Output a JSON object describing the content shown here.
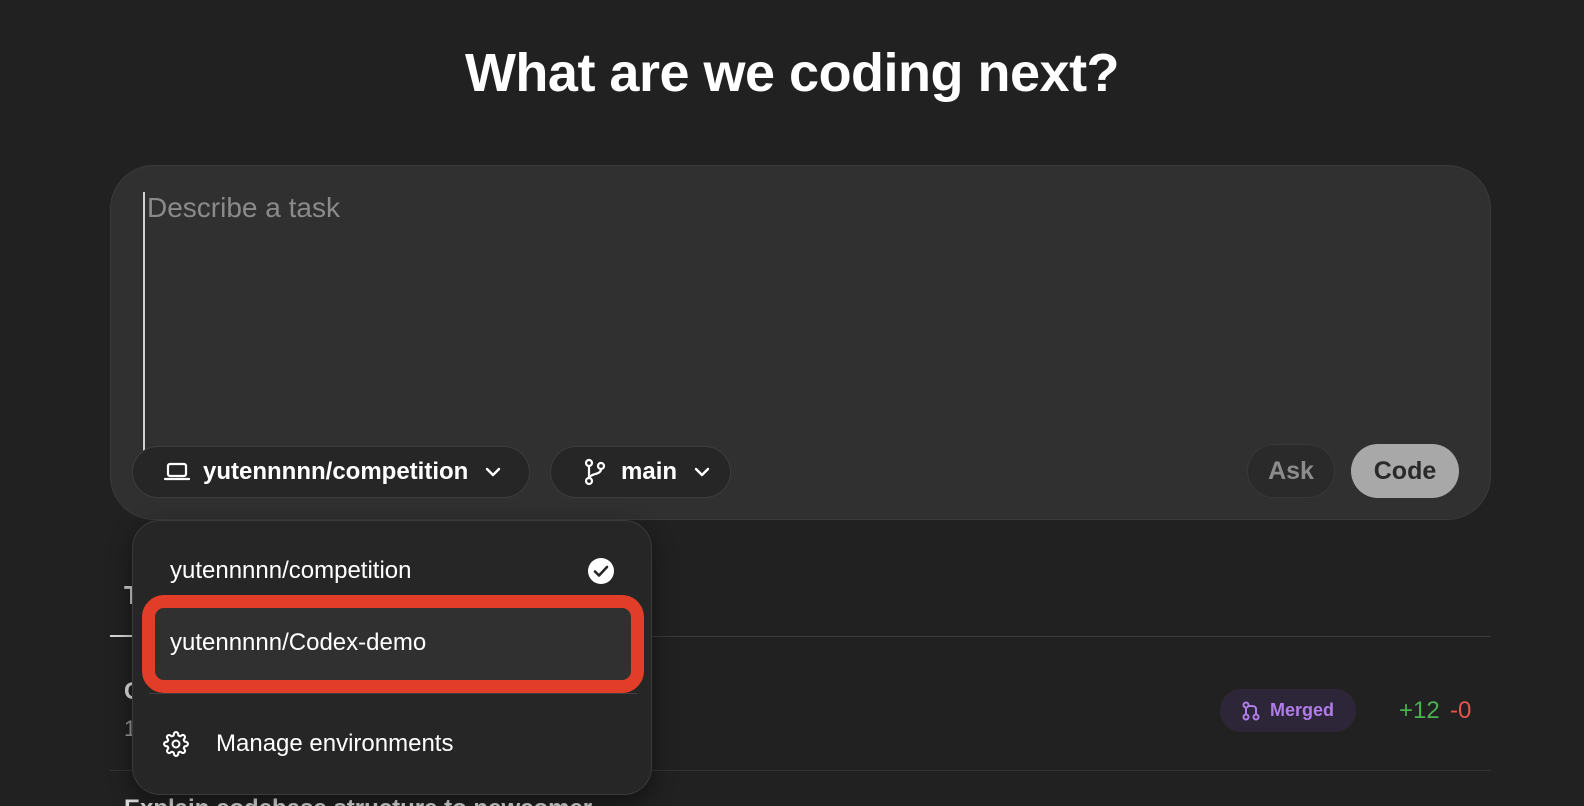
{
  "heading": "What are we coding next?",
  "composer": {
    "placeholder": "Describe a task",
    "environment": "yutennnnn/competition",
    "branch": "main",
    "ask_label": "Ask",
    "code_label": "Code"
  },
  "task_list": {
    "tab_stub": "T",
    "rows": [
      {
        "title_stub": "C",
        "meta_stub": "1",
        "status": "Merged",
        "additions": "+12",
        "deletions": "-0"
      },
      {
        "title": "Explain codebase structure to newcomer"
      }
    ]
  },
  "dropdown": {
    "items": [
      {
        "label": "yutennnnn/competition",
        "selected": true
      },
      {
        "label": "yutennnnn/Codex-demo",
        "selected": false,
        "highlighted": true
      }
    ],
    "manage_label": "Manage environments"
  },
  "colors": {
    "background": "#212121",
    "composer": "#303030",
    "highlight": "#e23d28",
    "merged": "#b07ce8",
    "additions": "#4caf50",
    "deletions": "#e5534b"
  },
  "icons": {
    "environment": "laptop-icon",
    "branch": "git-branch-icon",
    "chevron": "chevron-down-icon",
    "selected": "check-circle-icon",
    "manage": "gear-icon",
    "merged": "git-merge-icon"
  }
}
